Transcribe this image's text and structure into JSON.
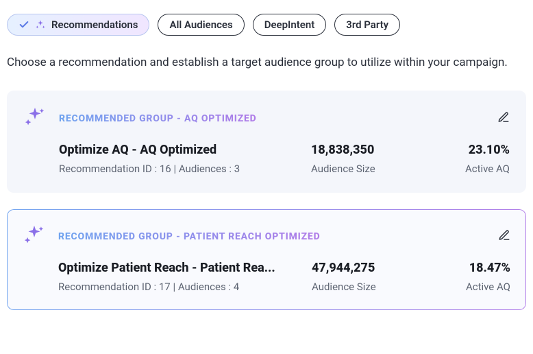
{
  "tabs": {
    "recommendations": "Recommendations",
    "all_audiences": "All Audiences",
    "deepintent": "DeepIntent",
    "third_party": "3rd Party"
  },
  "description": "Choose a recommendation and establish a target audience group to utilize within your campaign.",
  "cards": [
    {
      "group_label": "RECOMMENDED GROUP - AQ OPTIMIZED",
      "title": "Optimize AQ - AQ Optimized",
      "meta": "Recommendation ID : 16 | Audiences : 3",
      "audience_size_value": "18,838,350",
      "audience_size_label": "Audience Size",
      "active_aq_value": "23.10%",
      "active_aq_label": "Active AQ"
    },
    {
      "group_label": "RECOMMENDED GROUP - PATIENT REACH OPTIMIZED",
      "title": "Optimize Patient Reach - Patient Rea...",
      "meta": "Recommendation ID : 17 | Audiences : 4",
      "audience_size_value": "47,944,275",
      "audience_size_label": "Audience Size",
      "active_aq_value": "18.47%",
      "active_aq_label": "Active AQ"
    }
  ]
}
